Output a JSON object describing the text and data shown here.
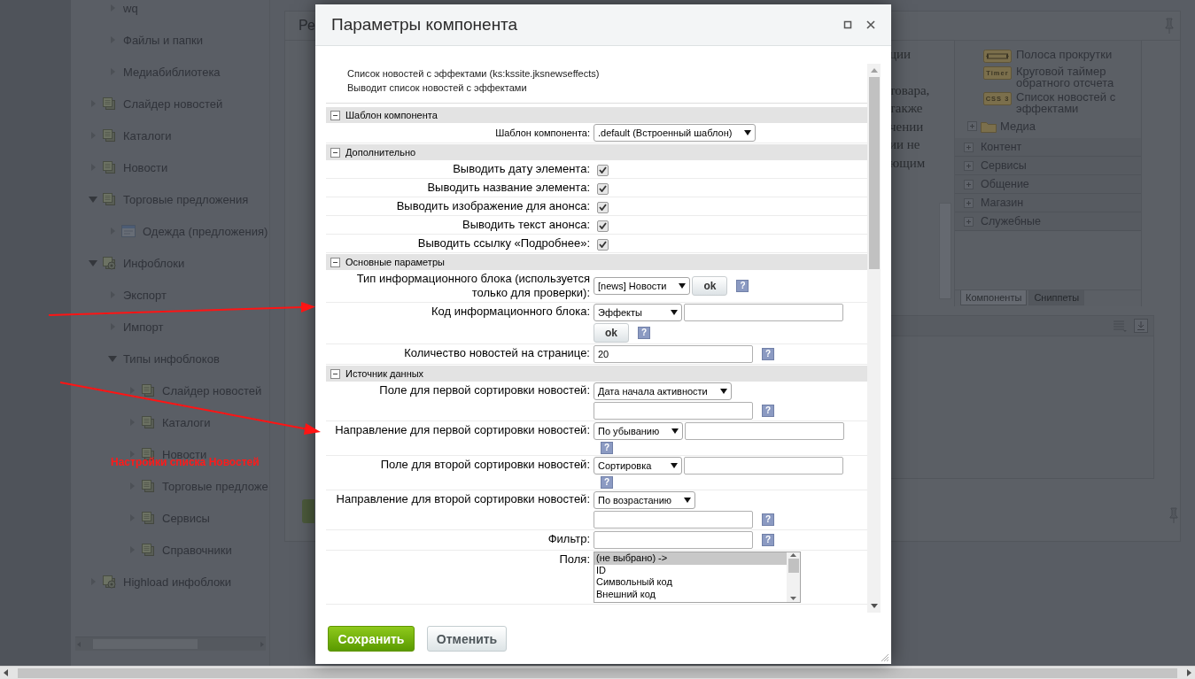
{
  "sidebar": {
    "partial_items": [
      {
        "label": "wq",
        "kind": "plain",
        "expanded": false
      },
      {
        "label": "Файлы и папки",
        "kind": "plain",
        "expanded": false
      },
      {
        "label": "Медиабиблиотека",
        "kind": "plain",
        "expanded": false
      }
    ],
    "items": [
      {
        "label": "Слайдер новостей",
        "kind": "iblock",
        "expanded": false
      },
      {
        "label": "Каталоги",
        "kind": "iblock",
        "expanded": false
      },
      {
        "label": "Новости",
        "kind": "iblock",
        "expanded": false
      },
      {
        "label": "Торговые предложения",
        "kind": "iblock",
        "expanded": true,
        "children": [
          {
            "label": "Одежда (предложения)",
            "kind": "catalog",
            "expanded": false
          }
        ]
      },
      {
        "label": "Инфоблоки",
        "kind": "group",
        "expanded": true,
        "children": [
          {
            "label": "Экспорт",
            "kind": "plain",
            "expanded": false
          },
          {
            "label": "Импорт",
            "kind": "plain",
            "expanded": false
          },
          {
            "label": "Типы инфоблоков",
            "kind": "plain",
            "expanded": true,
            "children": [
              {
                "label": "Слайдер новостей",
                "kind": "iblock",
                "expanded": false
              },
              {
                "label": "Каталоги",
                "kind": "iblock",
                "expanded": false
              },
              {
                "label": "Новости",
                "kind": "iblock",
                "expanded": false
              },
              {
                "label": "Торговые предложе",
                "kind": "iblock",
                "expanded": false
              },
              {
                "label": "Сервисы",
                "kind": "iblock",
                "expanded": false
              },
              {
                "label": "Справочники",
                "kind": "iblock",
                "expanded": false
              }
            ]
          }
        ]
      },
      {
        "label": "Highload инфоблоки",
        "kind": "group",
        "expanded": false
      }
    ]
  },
  "editor": {
    "tab_title": "Ре",
    "text_lines": [
      "ции",
      "товара,",
      "также",
      "чении",
      "ии не",
      "ющим"
    ]
  },
  "components_panel": {
    "items": [
      {
        "label": "Полоса прокрутки",
        "kind": "drawing"
      },
      {
        "label": "Круговой таймер обратного отсчета",
        "kind": "badge",
        "badge": "Timer"
      },
      {
        "label": "Список новостей с эффектами",
        "kind": "badge",
        "badge": "CSS 3"
      }
    ],
    "folder": {
      "label": "Медиа",
      "expanded": false
    },
    "groups": [
      {
        "label": "Контент",
        "expanded": false
      },
      {
        "label": "Сервисы",
        "expanded": false
      },
      {
        "label": "Общение",
        "expanded": false
      },
      {
        "label": "Магазин",
        "expanded": false
      },
      {
        "label": "Служебные",
        "expanded": false
      }
    ],
    "tabs": [
      {
        "label": "Компоненты",
        "selected": true
      },
      {
        "label": "Сниппеты",
        "selected": false
      }
    ]
  },
  "annotation": {
    "text": "Настройки списка Новостей"
  },
  "dialog": {
    "title": "Параметры компонента",
    "intro": [
      "Список новостей с эффектами (ks:kssite.jksnewseffects)",
      "Выводит список новостей с эффектами"
    ],
    "sections": [
      {
        "title": "Шаблон компонента",
        "expanded": true,
        "rows": [
          {
            "kind": "compact",
            "label": "Шаблон компонента:",
            "controls": [
              {
                "kind": "select",
                "value": ".default (Встроенный шаблон)"
              }
            ]
          }
        ]
      },
      {
        "title": "Дополнительно",
        "expanded": true,
        "rows": [
          {
            "kind": "normal",
            "label": "Выводить дату элемента:",
            "controls": [
              {
                "kind": "checkbox",
                "checked": true
              }
            ]
          },
          {
            "kind": "normal",
            "label": "Выводить название элемента:",
            "controls": [
              {
                "kind": "checkbox",
                "checked": true
              }
            ]
          },
          {
            "kind": "normal",
            "label": "Выводить изображение для анонса:",
            "controls": [
              {
                "kind": "checkbox",
                "checked": true
              }
            ]
          },
          {
            "kind": "normal",
            "label": "Выводить текст анонса:",
            "controls": [
              {
                "kind": "checkbox",
                "checked": true
              }
            ]
          },
          {
            "kind": "normal",
            "label": "Выводить ссылку «Подробнее»:",
            "controls": [
              {
                "kind": "checkbox",
                "checked": true
              }
            ]
          }
        ]
      },
      {
        "title": "Основные параметры",
        "expanded": true,
        "rows": [
          {
            "kind": "normal",
            "label": "Тип информационного блока (используется только для проверки):",
            "controls": [
              {
                "kind": "select",
                "value": "[news] Новости"
              },
              {
                "kind": "ok",
                "label": "ok"
              },
              {
                "kind": "help",
                "label": "?"
              }
            ]
          },
          {
            "kind": "normal",
            "label": "Код информационного блока:",
            "controls": [
              {
                "kind": "select",
                "value": "Эффекты"
              },
              {
                "kind": "input"
              },
              {
                "kind": "ok",
                "label": "ok"
              },
              {
                "kind": "help",
                "label": "?"
              }
            ]
          },
          {
            "kind": "normal",
            "label": "Количество новостей на странице:",
            "controls": [
              {
                "kind": "input",
                "value": "20"
              },
              {
                "kind": "help",
                "label": "?"
              }
            ]
          }
        ]
      },
      {
        "title": "Источник данных",
        "expanded": true,
        "rows": [
          {
            "kind": "normal",
            "label": "Поле для первой сортировки новостей:",
            "controls": [
              {
                "kind": "select",
                "value": "Дата начала активности"
              },
              {
                "kind": "input"
              },
              {
                "kind": "help",
                "label": "?"
              }
            ]
          },
          {
            "kind": "normal",
            "label": "Направление для первой сортировки новостей:",
            "controls": [
              {
                "kind": "select",
                "value": "По убыванию"
              },
              {
                "kind": "input"
              },
              {
                "kind": "help",
                "label": "?"
              }
            ]
          },
          {
            "kind": "normal",
            "label": "Поле для второй сортировки новостей:",
            "controls": [
              {
                "kind": "select",
                "value": "Сортировка"
              },
              {
                "kind": "input"
              },
              {
                "kind": "help",
                "label": "?"
              }
            ]
          },
          {
            "kind": "normal",
            "label": "Направление для второй сортировки новостей:",
            "controls": [
              {
                "kind": "select",
                "value": "По возрастанию"
              },
              {
                "kind": "input"
              },
              {
                "kind": "help",
                "label": "?"
              }
            ]
          },
          {
            "kind": "normal",
            "label": "Фильтр:",
            "controls": [
              {
                "kind": "input"
              },
              {
                "kind": "help",
                "label": "?"
              }
            ]
          },
          {
            "kind": "normal",
            "label": "Поля:",
            "controls": [
              {
                "kind": "listbox",
                "options": [
                  {
                    "label": "(не выбрано) ->",
                    "selected": true
                  },
                  {
                    "label": "ID",
                    "selected": false
                  },
                  {
                    "label": "Символьный код",
                    "selected": false
                  },
                  {
                    "label": "Внешний код",
                    "selected": false
                  }
                ]
              }
            ]
          }
        ]
      }
    ],
    "buttons": [
      {
        "kind": "primary",
        "label": "Сохранить"
      },
      {
        "kind": "secondary",
        "label": "Отменить"
      }
    ]
  }
}
